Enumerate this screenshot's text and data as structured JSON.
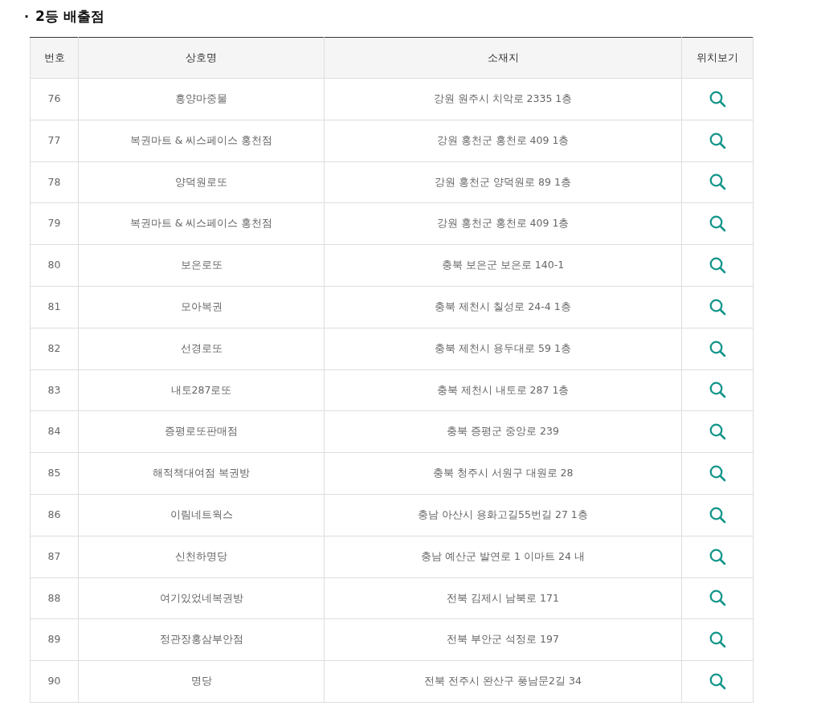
{
  "section": {
    "bullet": "·",
    "title": "2등 배출점"
  },
  "table": {
    "columns": [
      "번호",
      "상호명",
      "소재지",
      "위치보기"
    ],
    "rows": [
      {
        "no": "76",
        "name": "흥양마중물",
        "address": "강원 원주시 치악로 2335 1층"
      },
      {
        "no": "77",
        "name": "복권마트 & 씨스페이스 홍천점",
        "address": "강원 홍천군 홍천로 409 1층"
      },
      {
        "no": "78",
        "name": "양덕원로또",
        "address": "강원 홍천군 양덕원로 89 1층"
      },
      {
        "no": "79",
        "name": "복권마트 & 씨스페이스 홍천점",
        "address": "강원 홍천군 홍천로 409 1층"
      },
      {
        "no": "80",
        "name": "보은로또",
        "address": "충북 보은군 보은로 140-1"
      },
      {
        "no": "81",
        "name": "모아복권",
        "address": "충북 제천시 칠성로 24-4 1층"
      },
      {
        "no": "82",
        "name": "선경로또",
        "address": "충북 제천시 용두대로 59 1층"
      },
      {
        "no": "83",
        "name": "내토287로또",
        "address": "충북 제천시 내토로 287 1층"
      },
      {
        "no": "84",
        "name": "증평로또판매점",
        "address": "충북 증평군 중앙로 239"
      },
      {
        "no": "85",
        "name": "해적책대여점 복권방",
        "address": "충북 청주시 서원구 대원로 28"
      },
      {
        "no": "86",
        "name": "이림네트웍스",
        "address": "충남 아산시 용화고길55번길 27 1층"
      },
      {
        "no": "87",
        "name": "신천하명당",
        "address": "충남 예산군 발연로 1 이마트 24 내"
      },
      {
        "no": "88",
        "name": "여기있었네복권방",
        "address": "전북 김제시 남북로 171"
      },
      {
        "no": "89",
        "name": "정관장홍삼부안점",
        "address": "전북 부안군 석정로 197"
      },
      {
        "no": "90",
        "name": "명당",
        "address": "전북 전주시 완산구 풍남문2길 34"
      }
    ]
  }
}
